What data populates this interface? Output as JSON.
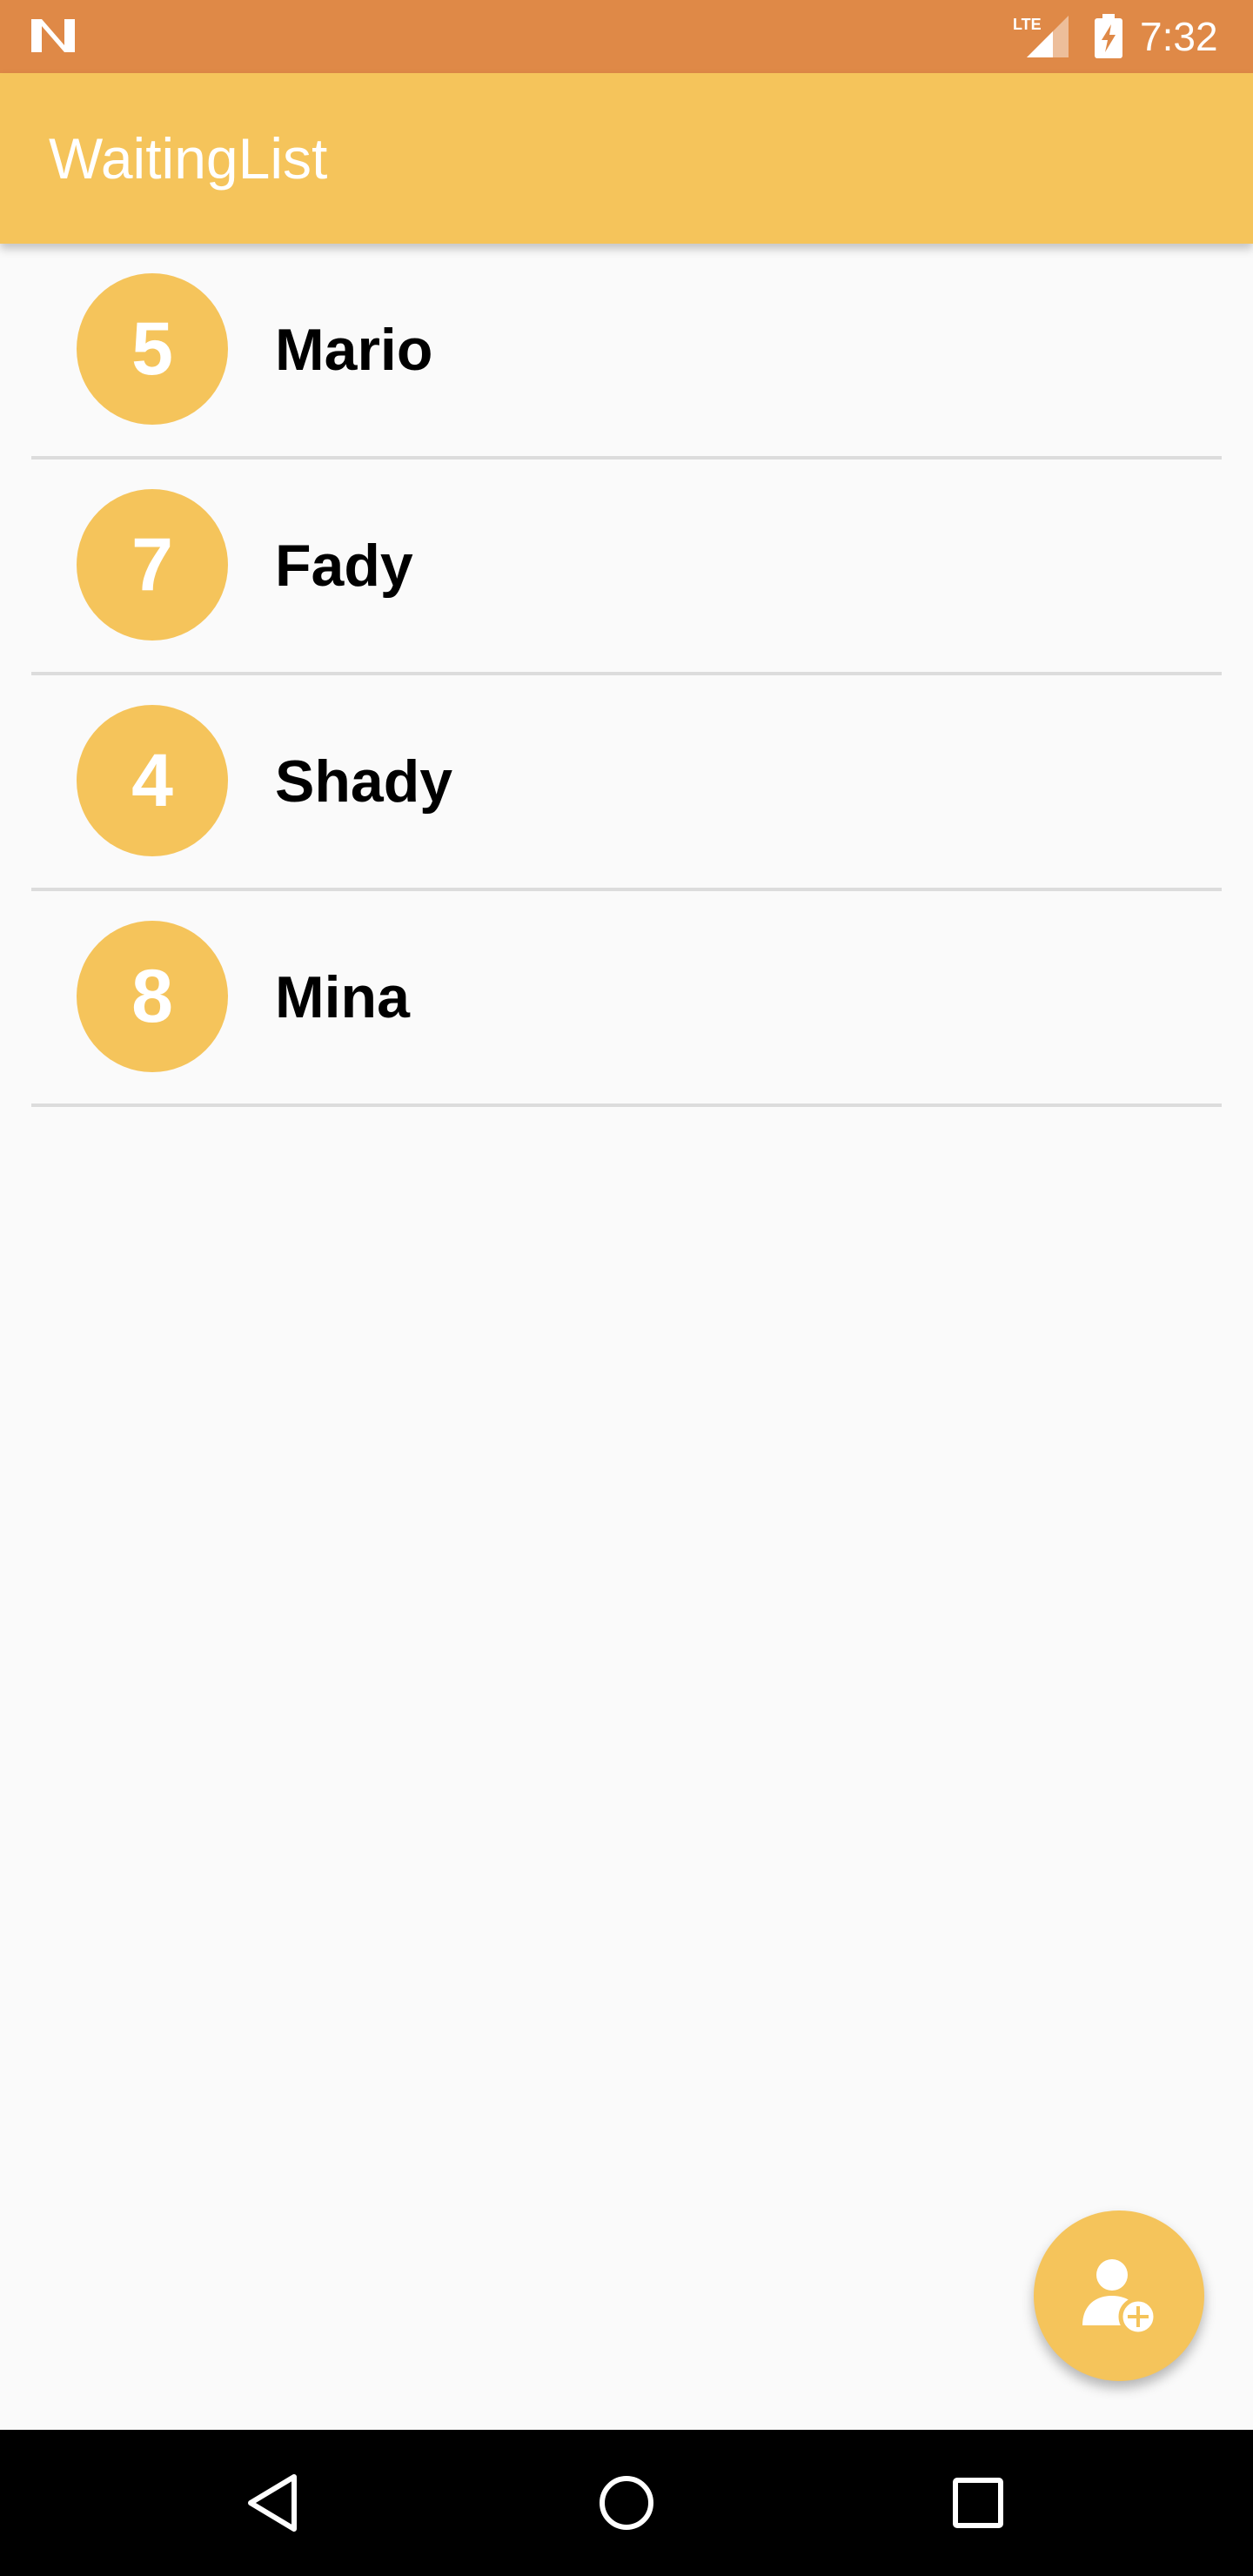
{
  "status_bar": {
    "time": "7:32",
    "network": "LTE",
    "icons": [
      "n-icon",
      "lte-signal-icon",
      "battery-charging-icon"
    ]
  },
  "app_bar": {
    "title": "WaitingList"
  },
  "guests": [
    {
      "party_size": "5",
      "name": "Mario"
    },
    {
      "party_size": "7",
      "name": "Fady"
    },
    {
      "party_size": "4",
      "name": "Shady"
    },
    {
      "party_size": "8",
      "name": "Mina"
    }
  ],
  "fab": {
    "icon": "add-person-icon"
  },
  "nav_bar": {
    "icons": [
      "back-icon",
      "home-icon",
      "recents-icon"
    ]
  },
  "colors": {
    "status_bar": "#DF8947",
    "primary": "#F5C45B",
    "background": "#FAFAFA",
    "divider": "#DCDCDC"
  }
}
